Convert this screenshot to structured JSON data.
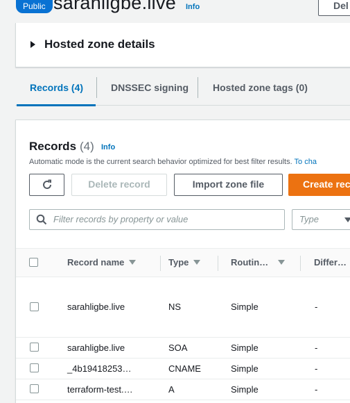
{
  "header": {
    "badge": "Public",
    "zone_name": "sarahligbe.live",
    "info": "Info",
    "delete_label": "Del"
  },
  "details": {
    "label": "Hosted zone details"
  },
  "tabs": [
    {
      "label": "Records (4)",
      "active": true
    },
    {
      "label": "DNSSEC signing",
      "active": false
    },
    {
      "label": "Hosted zone tags (0)",
      "active": false
    }
  ],
  "records": {
    "title": "Records",
    "count": "(4)",
    "info": "Info",
    "description": "Automatic mode is the current search behavior optimized for best filter results.",
    "description_link": "To cha",
    "delete_record": "Delete record",
    "import_zone_file": "Import zone file",
    "create_record": "Create rec",
    "search_placeholder": "Filter records by property or value",
    "type_placeholder": "Type",
    "columns": {
      "record_name": "Record name",
      "type": "Type",
      "routing": "Routin…",
      "differ": "Differ…"
    },
    "rows": [
      {
        "name": "sarahligbe.live",
        "type": "NS",
        "routing": "Simple",
        "differ": "-"
      },
      {
        "name": "sarahligbe.live",
        "type": "SOA",
        "routing": "Simple",
        "differ": "-"
      },
      {
        "name": "_4b19418253…",
        "type": "CNAME",
        "routing": "Simple",
        "differ": "-"
      },
      {
        "name": "terraform-test.…",
        "type": "A",
        "routing": "Simple",
        "differ": "-"
      }
    ]
  },
  "colors": {
    "accent": "#0073bb",
    "primary_button": "#ec7211",
    "badge": "#0972d3"
  }
}
